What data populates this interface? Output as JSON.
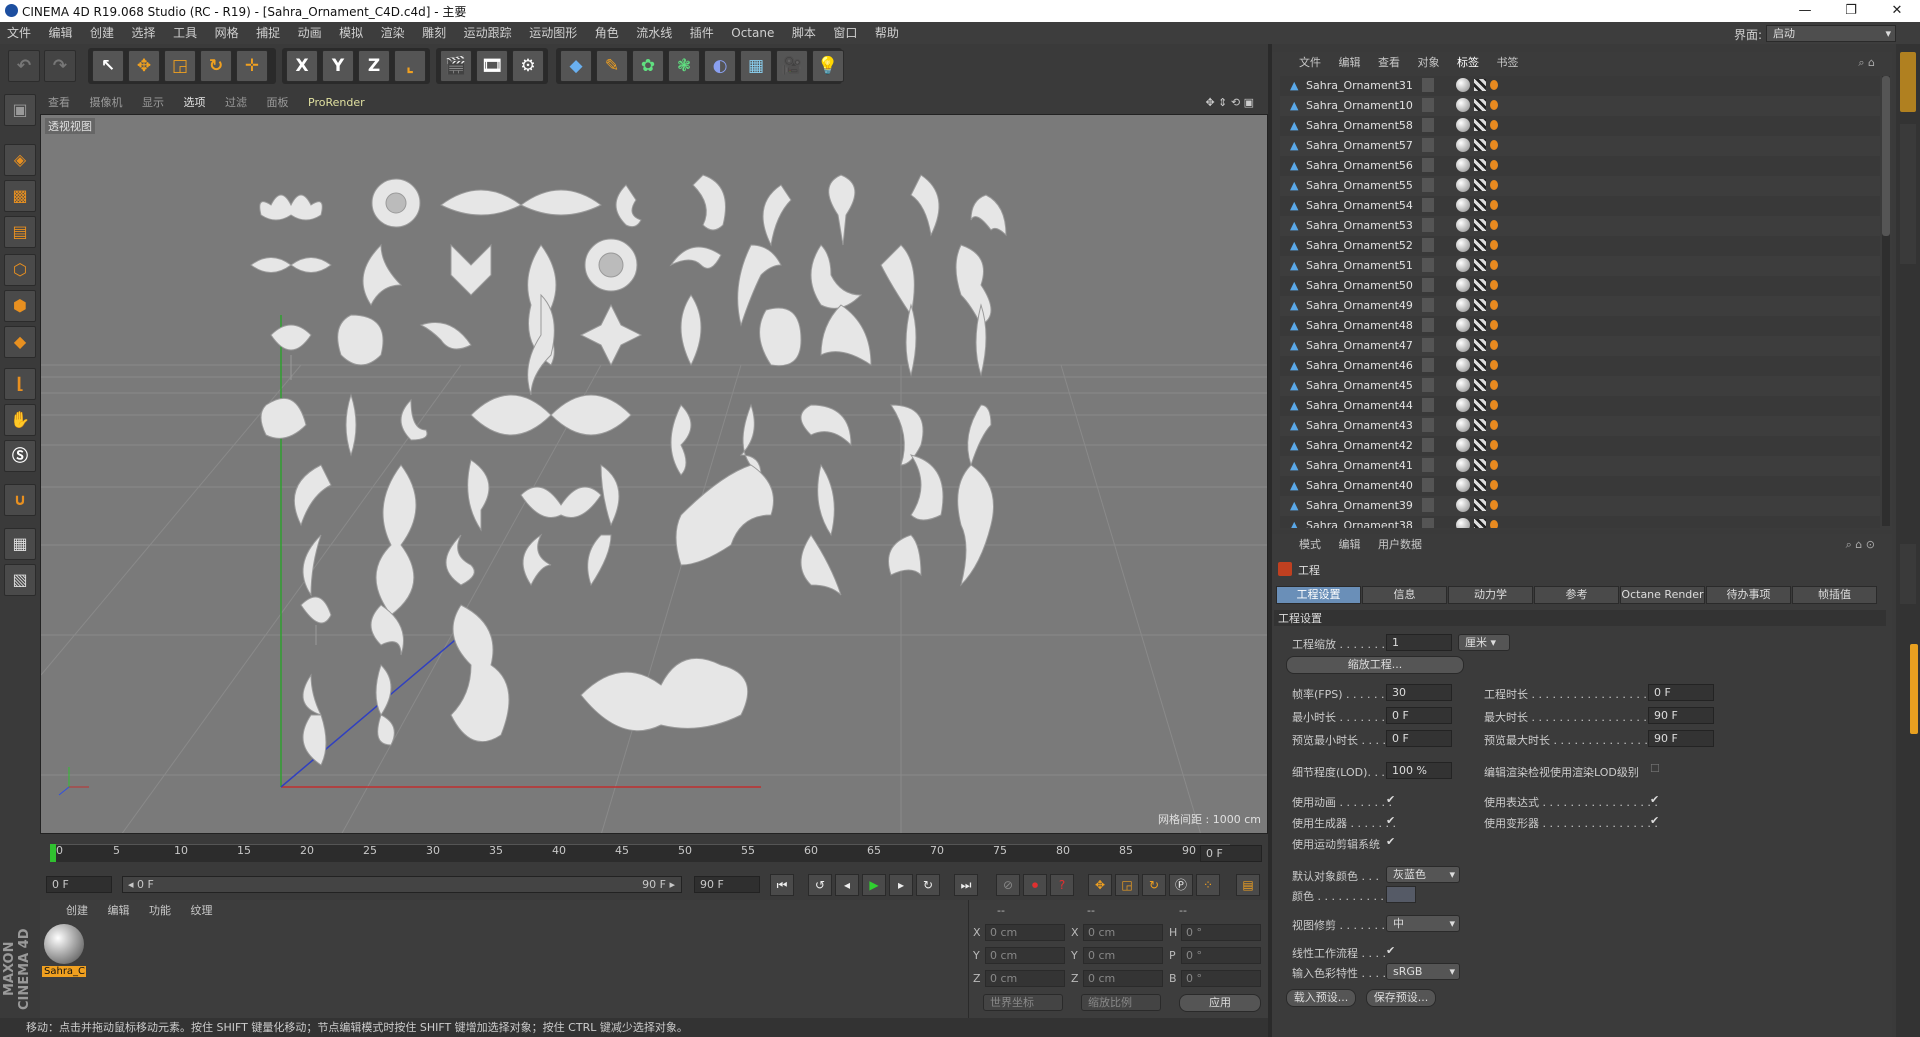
{
  "window": {
    "title": "CINEMA 4D R19.068 Studio (RC - R19) - [Sahra_Ornament_C4D.c4d] - 主要"
  },
  "menu": [
    "文件",
    "编辑",
    "创建",
    "选择",
    "工具",
    "网格",
    "捕捉",
    "动画",
    "模拟",
    "渲染",
    "雕刻",
    "运动跟踪",
    "运动图形",
    "角色",
    "流水线",
    "插件",
    "Octane",
    "脚本",
    "窗口",
    "帮助"
  ],
  "layout": {
    "label": "界面:",
    "value": "启动"
  },
  "viewport": {
    "menu": [
      "查看",
      "摄像机",
      "显示",
      "选项",
      "过滤",
      "面板",
      "ProRender"
    ],
    "label": "透视视图",
    "grid_spacing": "网格间距 : 1000 cm"
  },
  "timeline": {
    "ticks": [
      "0",
      "5",
      "10",
      "15",
      "20",
      "25",
      "30",
      "35",
      "40",
      "45",
      "50",
      "55",
      "60",
      "65",
      "70",
      "75",
      "80",
      "85",
      "90"
    ],
    "current_frame": "0 F"
  },
  "transport": {
    "start": "0 F",
    "range_start": "◂ 0 F",
    "range_end": "90 F ▸",
    "end": "90 F"
  },
  "material_manager": {
    "menu": [
      "创建",
      "编辑",
      "功能",
      "纹理"
    ],
    "material_name": "Sahra_C"
  },
  "coordinates": {
    "headers": [
      "--",
      "--",
      "--"
    ],
    "rows": [
      {
        "a": "X",
        "av": "0 cm",
        "b": "X",
        "bv": "0 cm",
        "c": "H",
        "cv": "0 °"
      },
      {
        "a": "Y",
        "av": "0 cm",
        "b": "Y",
        "bv": "0 cm",
        "c": "P",
        "cv": "0 °"
      },
      {
        "a": "Z",
        "av": "0 cm",
        "b": "Z",
        "bv": "0 cm",
        "c": "B",
        "cv": "0 °"
      }
    ],
    "world": "世界坐标",
    "scale": "缩放比例",
    "apply": "应用"
  },
  "status": "移动：点击并拖动鼠标移动元素。按住 SHIFT 键量化移动；节点编辑模式时按住 SHIFT 键增加选择对象；按住 CTRL 键减少选择对象。",
  "branding": "MAXON CINEMA 4D",
  "object_manager": {
    "menu": [
      "文件",
      "编辑",
      "查看",
      "对象",
      "标签",
      "书签"
    ],
    "objects": [
      "Sahra_Ornament31",
      "Sahra_Ornament10",
      "Sahra_Ornament58",
      "Sahra_Ornament57",
      "Sahra_Ornament56",
      "Sahra_Ornament55",
      "Sahra_Ornament54",
      "Sahra_Ornament53",
      "Sahra_Ornament52",
      "Sahra_Ornament51",
      "Sahra_Ornament50",
      "Sahra_Ornament49",
      "Sahra_Ornament48",
      "Sahra_Ornament47",
      "Sahra_Ornament46",
      "Sahra_Ornament45",
      "Sahra_Ornament44",
      "Sahra_Ornament43",
      "Sahra_Ornament42",
      "Sahra_Ornament41",
      "Sahra_Ornament40",
      "Sahra_Ornament39",
      "Sahra_Ornament38"
    ]
  },
  "attribute_manager": {
    "menu": [
      "模式",
      "编辑",
      "用户数据"
    ],
    "title": "工程",
    "tabs": [
      "工程设置",
      "信息",
      "动力学",
      "参考",
      "Octane Render",
      "待办事项",
      "帧插值"
    ],
    "section": "工程设置",
    "project_scale": {
      "label": "工程缩放 . . . . . . . .",
      "value": "1",
      "unit": "厘米"
    },
    "scale_button": "缩放工程...",
    "fps": {
      "label": "帧率(FPS) . . . . . . .",
      "value": "30"
    },
    "min_time": {
      "label": "最小时长 . . . . . . . .",
      "value": "0 F"
    },
    "preview_min": {
      "label": "预览最小时长 . . . .",
      "value": "0 F"
    },
    "project_time": {
      "label": "工程时长 . . . . . . . . . . . . . . . . . .",
      "value": "0 F"
    },
    "max_time": {
      "label": "最大时长 . . . . . . . . . . . . . . . . . .",
      "value": "90 F"
    },
    "preview_max": {
      "label": "预览最大时长 . . . . . . . . . . . . . . .",
      "value": "90 F"
    },
    "lod": {
      "label": "细节程度(LOD). . . .",
      "value": "100 %"
    },
    "render_lod": "编辑渲染检视使用渲染LOD级别",
    "use_animation": "使用动画 . . . . . . . .",
    "use_expression": "使用表达式 . . . . . . . . . . . . . . . . .",
    "use_generator": "使用生成器 . . . . . . .",
    "use_deformer": "使用变形器 . . . . . . . . . . . . . . . . .",
    "use_motion": "使用运动剪辑系统",
    "default_color": {
      "label": "默认对象颜色 . . .",
      "value": "灰蓝色"
    },
    "color": {
      "label": "颜色 . . . . . . . . . . . ."
    },
    "view_clip": {
      "label": "视图修剪 . . . . . . .",
      "value": "中"
    },
    "linear_workflow": "线性工作流程 . . . .",
    "color_profile": {
      "label": "输入色彩特性 . . . .",
      "value": "sRGB"
    },
    "load_preset": "载入预设...",
    "save_preset": "保存预设..."
  },
  "colors": {
    "active_tab": "#6a8fb8",
    "ornament": "#e6e6e6",
    "viewport_bg": "#7a7a7a",
    "accent": "#e89020"
  }
}
